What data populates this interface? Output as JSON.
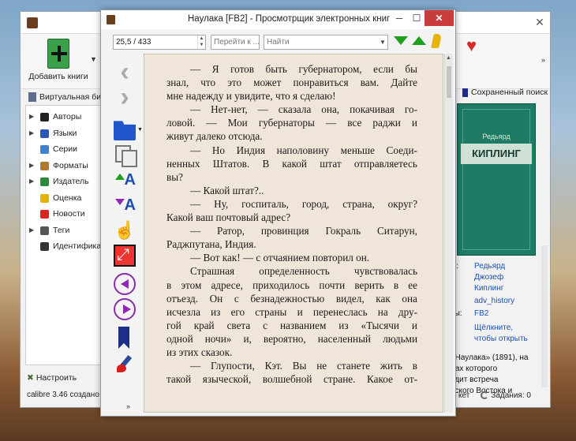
{
  "calibre": {
    "add_books": "Добавить книги",
    "virtual_library": "Виртуальная биб",
    "sidebar": [
      {
        "label": "Авторы",
        "color": "#222222",
        "arrow": true
      },
      {
        "label": "Языки",
        "color": "#2c57b8",
        "arrow": true
      },
      {
        "label": "Серии",
        "color": "#3c82d0",
        "arrow": false
      },
      {
        "label": "Форматы",
        "color": "#b07a2c",
        "arrow": true
      },
      {
        "label": "Издатель",
        "color": "#2c8a3c",
        "arrow": true
      },
      {
        "label": "Оценка",
        "color": "#e6b400",
        "arrow": false
      },
      {
        "label": "Новости",
        "color": "#d22",
        "arrow": false
      },
      {
        "label": "Теги",
        "color": "#555555",
        "arrow": true
      },
      {
        "label": "Идентификат",
        "color": "#333333",
        "arrow": false
      }
    ],
    "configure": "Настроить",
    "status_left": "calibre 3.46 создано",
    "saved_search": "Сохраненный поиск",
    "cover": {
      "author": "Редьярд",
      "title": "КИПЛИНГ"
    },
    "details": {
      "authors_label": "ы:",
      "authors": [
        "Редьярд",
        "Джозеф",
        "Киплинг"
      ],
      "tag": "adv_history",
      "formats_label": "ты:",
      "format": "FB2",
      "open_hint": [
        "Щёлкните,",
        "чтобы открыть"
      ],
      "desc": [
        "«Наулака» (1891), на",
        "дах которого",
        "одит встреча",
        "еского Востока и"
      ]
    },
    "status_right": {
      "prefix": "кет",
      "jobs": "Задания: 0"
    }
  },
  "viewer": {
    "title": "Наулака [FB2] - Просмотрщик электронных книг",
    "position": "25,5 / 433",
    "goto_placeholder": "Перейти к ...",
    "search_placeholder": "Найти",
    "text": [
      {
        "t": "— Я готов быть губернатором, если бы",
        "i": true
      },
      {
        "t": "знал, что это может понравиться вам. Дайте",
        "i": false
      },
      {
        "t": "мне надежду и увидите, что я сделаю!",
        "i": false,
        "last": true
      },
      {
        "t": "— Нет-нет, — сказала она, покачивая го-",
        "i": true
      },
      {
        "t": "ловой. — Мои губернаторы — все раджи и",
        "i": false
      },
      {
        "t": "живут далеко отсюда.",
        "i": false,
        "last": true
      },
      {
        "t": "— Но Индия наполовину меньше Соеди-",
        "i": true
      },
      {
        "t": "ненных Штатов. В какой штат отправляетесь",
        "i": false
      },
      {
        "t": "вы?",
        "i": false,
        "last": true
      },
      {
        "t": "— Какой штат?..",
        "i": true,
        "last": true
      },
      {
        "t": "— Ну, госпиталь, город, страна, округ?",
        "i": true
      },
      {
        "t": "Какой ваш почтовый адрес?",
        "i": false,
        "last": true
      },
      {
        "t": "— Ратор, провинция Гокраль Ситарун,",
        "i": true
      },
      {
        "t": "Раджпутана, Индия.",
        "i": false,
        "last": true
      },
      {
        "t": "— Вот как! — с отчаянием повторил он.",
        "i": true,
        "last": true
      },
      {
        "t": "Страшная определенность чувствовалась",
        "i": true
      },
      {
        "t": "в этом адресе, приходилось почти верить в ее",
        "i": false
      },
      {
        "t": "отъезд. Он с безнадежностью видел, как она",
        "i": false
      },
      {
        "t": "исчезла из его страны и перенеслась на дру-",
        "i": false
      },
      {
        "t": "гой край света с названием из «Тысячи и",
        "i": false
      },
      {
        "t": "одной ночи» и, вероятно, населенный людьми",
        "i": false
      },
      {
        "t": "из этих сказок.",
        "i": false,
        "last": true
      },
      {
        "t": "— Глупости, Кэт. Вы не станете жить в",
        "i": true
      },
      {
        "t": "такой языческой, волшебной стране. Какое от-",
        "i": false
      }
    ]
  }
}
